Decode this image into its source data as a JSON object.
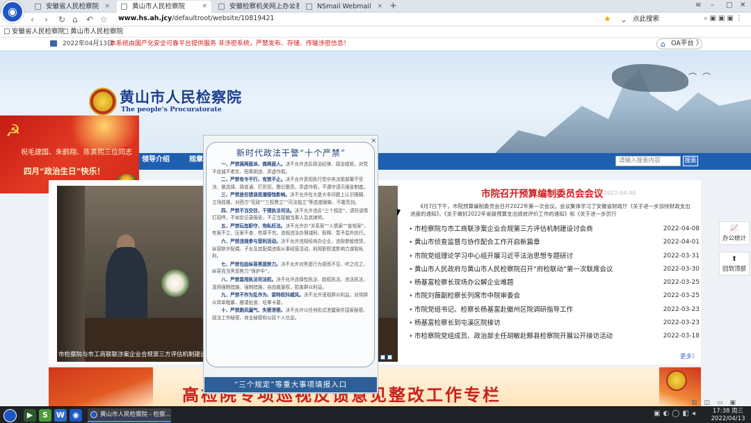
{
  "browser": {
    "tabs": [
      {
        "label": "安徽省人民检察院"
      },
      {
        "label": "黄山市人民检察院"
      },
      {
        "label": "安徽检察机关网上办公系"
      },
      {
        "label": "NSmail Webmail"
      }
    ],
    "tab_close": "×",
    "tab_add": "+",
    "address_host": "www.hs.ah.jcy",
    "address_path": "/defaultroot/website/10819421",
    "search_placeholder": "点此搜索",
    "bookmarks": [
      {
        "label": "安徽省人民检察院"
      },
      {
        "label": "黄山市人民检察院"
      }
    ]
  },
  "notice": {
    "date": "2022年04月13日",
    "text": "本系统由国产化安全可靠平台提供服务 非涉密系统，严禁发布、存储、传输涉密信息！",
    "oa_label": "OA平台 〉"
  },
  "header": {
    "title": "黄山市人民检察院",
    "subtitle": "The people's Procuratorate"
  },
  "nav": {
    "items": [
      {
        "label": "领导介绍"
      },
      {
        "label": "规章"
      }
    ],
    "search_placeholder": "请输入搜索内容",
    "search_button": "搜索"
  },
  "holiday_card": {
    "line1": "祝毛建国、朱鹤翔、陈黄熙三位同志",
    "line2": "四月“政治生日”快乐！"
  },
  "modal": {
    "close": "×",
    "title": "新时代政法干警“十个严禁”",
    "rules": [
      {
        "head": "一、严禁搞两面派、做两面人。",
        "body": "决不允许违反政治纪律、政治规矩，对党不忠诚不老实、阳奉阴违、弄虚作假。"
      },
      {
        "head": "二、严禁有令不行、有禁不止。",
        "body": "决不允许贯彻执行党中央决策部署不坚决、做选择、搞变通、打折扣，敷衍塞责，弄虚作假，不遵守请示报告制度。"
      },
      {
        "head": "三、严禁放任错误思潮侵蚀影响。",
        "body": "决不允许在大是大非问题上认识模糊、立场摇摆，对西方“宪政”“三权鼎立”“司法独立”等态度暧昧、不敢亮剑。"
      },
      {
        "head": "四、严禁不当交往、干预执法司法。",
        "body": "决不允许违反“三个规定”，请托说情打招呼，不如实记录报告，不正当接触当事人及其律师。"
      },
      {
        "head": "五、严禁玩忽职守、徇私枉法。",
        "body": "决不允许办“关系案”“人情案”“金钱案”，有案不立、压案不查、有罪不究，违规违法办理减刑、假释、暂予监外执行。"
      },
      {
        "head": "六、严禁违规参与营利活动。",
        "body": "决不允许违规经商办企业，违规参股借贷，纵容默许配偶、子女及其配偶违规从事经营活动，利用职权或影响力谋取私利。"
      },
      {
        "head": "七、严禁包庇纵容黑恶势力。",
        "body": "决不允许对黑恶行为视而不见、听之任之，纵容充当黑恶势力“保护伞”。"
      },
      {
        "head": "八、严禁滥用执法司法权。",
        "body": "决不允许选择性执法、超权执法、违法执法，滥用强制措施、强制措施，自由裁量权，损害群众利益。"
      },
      {
        "head": "九、严禁不作为乱作为、耍特权抖威风。",
        "body": "决不允许漠视群众利益，对待群众简单粗暴、推诿扯皮、吃拿卡要。"
      },
      {
        "head": "十、严禁跑风漏气、失密泄密。",
        "body": "决不允许以任何形式泄露案件国家秘密、政法工作秘密、商业秘密和公民个人信息。"
      }
    ],
    "footer": "“三个规定”等重大事项填报入口"
  },
  "slideshow": {
    "caption": "市检察院与市工商联联涉案企业合规第三方评估机制建设研讨会"
  },
  "feature": {
    "headline": "市院召开预算编制委员会会议",
    "date": "2022-04-08",
    "summary": "4月7日下午，市院预算编制委员会召开2022年第一次会议。会议集体学习了安徽省财政厅《关于进一步加快财政支出进度的通知》、《关于做好2022年省级预算支出绩效评价工作的通知》和《关于进一步厉行"
  },
  "news": [
    {
      "title": "市检察院与市工商联涉案企业合规第三方评估机制建设讨会商",
      "date": "2022-04-08"
    },
    {
      "title": "黄山市侦查监督与协作配合工作开启新篇章",
      "date": "2022-04-01"
    },
    {
      "title": "市院党组理论学习中心组开展习近平法治思想专题研讨",
      "date": "2022-03-31"
    },
    {
      "title": "黄山市人民政府与黄山市人民检察院召开“府检联动”第一次联席会议",
      "date": "2022-03-30"
    },
    {
      "title": "杨基富检察长现场办公解企业难题",
      "date": "2022-03-25"
    },
    {
      "title": "市院刘薇副检察长列席市中院审委会",
      "date": "2022-03-25"
    },
    {
      "title": "市院党组书记、检察长杨基富赴徽州区院调研指导工作",
      "date": "2022-03-23"
    },
    {
      "title": "杨基富检察长到屯溪区院接访",
      "date": "2022-03-23"
    },
    {
      "title": "市检察院党组成员、政治部主任胡敏赴黟县检察院开展公开接访活动",
      "date": "2022-03-18"
    }
  ],
  "more_label": "更多〉",
  "float_buttons": [
    {
      "label": "办公统计",
      "icon": "chart-icon"
    },
    {
      "label": "回到顶部",
      "icon": "arrow-up-icon"
    }
  ],
  "lower_banner": {
    "title": "高检院专项巡视反馈意见整改工作专栏"
  },
  "taskbar": {
    "window_label": "黄山市人民检察院 - 检察...",
    "time": "17:38 周三",
    "date": "2022/04/13"
  }
}
